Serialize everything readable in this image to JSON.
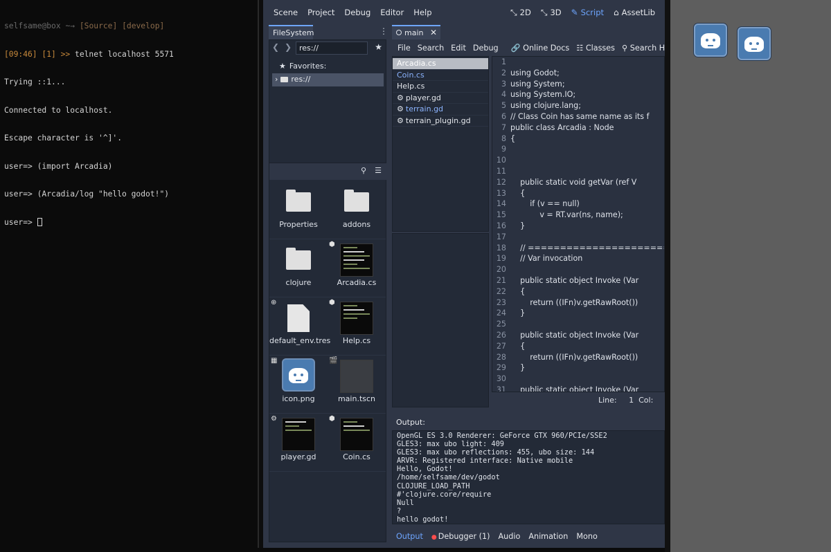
{
  "terminal": {
    "prompt_user": "selfsame",
    "prompt_at": "@",
    "prompt_host": "box",
    "prompt_rest": " ~→ ",
    "prompt_source": "[Source]",
    "prompt_branch": "[develop]",
    "time_prefix": "[09:46] [1] >> ",
    "command": "telnet localhost 5571",
    "lines": [
      "Trying ::1...",
      "Connected to localhost.",
      "Escape character is '^]'.",
      "user=> (import Arcadia)",
      "user=> (Arcadia/log \"hello godot!\")",
      "user=> "
    ]
  },
  "menubar": {
    "items": [
      "Scene",
      "Project",
      "Debug",
      "Editor",
      "Help"
    ],
    "modes": [
      {
        "label": "2D",
        "icon": "2d-icon",
        "glyph": "⤡"
      },
      {
        "label": "3D",
        "icon": "3d-icon",
        "glyph": "⤡"
      },
      {
        "label": "Script",
        "icon": "script-icon",
        "glyph": "✎"
      },
      {
        "label": "AssetLib",
        "icon": "assetlib-icon",
        "glyph": "⌂"
      }
    ],
    "active_mode": "Script"
  },
  "filesystem": {
    "tab_label": "FileSystem",
    "path_value": "res://",
    "favorites_label": "Favorites:",
    "root_label": "res://",
    "items": [
      {
        "name": "Properties",
        "kind": "folder"
      },
      {
        "name": "addons",
        "kind": "folder"
      },
      {
        "name": "clojure",
        "kind": "folder"
      },
      {
        "name": "Arcadia.cs",
        "kind": "script-thumb",
        "badge": "⬢"
      },
      {
        "name": "default_env.tres",
        "kind": "doc",
        "badge": "⊕"
      },
      {
        "name": "Help.cs",
        "kind": "script-thumb",
        "badge": "⬢"
      },
      {
        "name": "icon.png",
        "kind": "image",
        "badge": "▦"
      },
      {
        "name": "main.tscn",
        "kind": "scene-thumb",
        "badge": "🎬"
      },
      {
        "name": "player.gd",
        "kind": "script-thumb",
        "badge": "⚙"
      },
      {
        "name": "Coin.cs",
        "kind": "script-thumb",
        "badge": "⬢"
      }
    ]
  },
  "script_editor": {
    "tab_label": "main",
    "menu": {
      "file": "File",
      "search": "Search",
      "edit": "Edit",
      "debug": "Debug",
      "online_docs": "Online Docs",
      "classes": "Classes",
      "search_help": "Search Help"
    },
    "scripts": [
      {
        "name": "Arcadia.cs",
        "selected": true,
        "gd": false
      },
      {
        "name": "Coin.cs",
        "selected": false,
        "gd": false
      },
      {
        "name": "Help.cs",
        "selected": false,
        "gd": false
      },
      {
        "name": "player.gd",
        "selected": false,
        "gd": true
      },
      {
        "name": "terrain.gd",
        "selected": false,
        "gd": true
      },
      {
        "name": "terrain_plugin.gd",
        "selected": false,
        "gd": true
      }
    ],
    "code_lines": [
      [],
      [
        [
          "kw",
          "using"
        ],
        [
          "tx",
          " Godot;"
        ]
      ],
      [
        [
          "kw",
          "using"
        ],
        [
          "tx",
          " System;"
        ]
      ],
      [
        [
          "kw",
          "using"
        ],
        [
          "tx",
          " System.IO;"
        ]
      ],
      [
        [
          "kw",
          "using"
        ],
        [
          "tx",
          " clojure.lang;"
        ]
      ],
      [
        [
          "cm",
          "// Class Coin has same name as its f"
        ]
      ],
      [
        [
          "kw",
          "public"
        ],
        [
          "tx",
          " "
        ],
        [
          "kw",
          "class"
        ],
        [
          "tx",
          " Arcadia : "
        ],
        [
          "ty",
          "Node"
        ]
      ],
      [
        [
          "tx",
          "{"
        ]
      ],
      [],
      [],
      [],
      [
        [
          "tx",
          "    "
        ],
        [
          "kw",
          "public"
        ],
        [
          "tx",
          " "
        ],
        [
          "kw",
          "static"
        ],
        [
          "tx",
          " "
        ],
        [
          "kw",
          "void"
        ],
        [
          "tx",
          " "
        ],
        [
          "fn",
          "getVar"
        ],
        [
          "tx",
          " ("
        ],
        [
          "kw",
          "ref"
        ],
        [
          "tx",
          " V"
        ]
      ],
      [
        [
          "tx",
          "    {"
        ]
      ],
      [
        [
          "tx",
          "        "
        ],
        [
          "kw",
          "if"
        ],
        [
          "tx",
          " (v == "
        ],
        [
          "kw",
          "null"
        ],
        [
          "tx",
          ")"
        ]
      ],
      [
        [
          "tx",
          "            v = RT."
        ],
        [
          "fn",
          "var"
        ],
        [
          "tx",
          "(ns, name);"
        ]
      ],
      [
        [
          "tx",
          "    }"
        ]
      ],
      [],
      [
        [
          "tx",
          "    "
        ],
        [
          "cm",
          "// ==============================="
        ]
      ],
      [
        [
          "tx",
          "    "
        ],
        [
          "cm",
          "// Var invocation"
        ]
      ],
      [],
      [
        [
          "tx",
          "    "
        ],
        [
          "kw",
          "public"
        ],
        [
          "tx",
          " "
        ],
        [
          "kw",
          "static"
        ],
        [
          "tx",
          " "
        ],
        [
          "kw",
          "object"
        ],
        [
          "tx",
          " "
        ],
        [
          "fn",
          "Invoke"
        ],
        [
          "tx",
          " (Var"
        ]
      ],
      [
        [
          "tx",
          "    {"
        ]
      ],
      [
        [
          "tx",
          "        "
        ],
        [
          "kw",
          "return"
        ],
        [
          "tx",
          " ((IFn)v."
        ],
        [
          "fn",
          "getRawRoot"
        ],
        [
          "tx",
          "())"
        ]
      ],
      [
        [
          "tx",
          "    }"
        ]
      ],
      [],
      [
        [
          "tx",
          "    "
        ],
        [
          "kw",
          "public"
        ],
        [
          "tx",
          " "
        ],
        [
          "kw",
          "static"
        ],
        [
          "tx",
          " "
        ],
        [
          "kw",
          "object"
        ],
        [
          "tx",
          " "
        ],
        [
          "fn",
          "Invoke"
        ],
        [
          "tx",
          " (Var"
        ]
      ],
      [
        [
          "tx",
          "    {"
        ]
      ],
      [
        [
          "tx",
          "        "
        ],
        [
          "kw",
          "return"
        ],
        [
          "tx",
          " ((IFn)v."
        ],
        [
          "fn",
          "getRawRoot"
        ],
        [
          "tx",
          "())"
        ]
      ],
      [
        [
          "tx",
          "    }"
        ]
      ],
      [],
      [
        [
          "tx",
          "    "
        ],
        [
          "kw",
          "public"
        ],
        [
          "tx",
          " "
        ],
        [
          "kw",
          "static"
        ],
        [
          "tx",
          " "
        ],
        [
          "kw",
          "object"
        ],
        [
          "tx",
          " "
        ],
        [
          "fn",
          "Invoke"
        ],
        [
          "tx",
          " (Var"
        ]
      ]
    ],
    "status_line_label": "Line:",
    "status_line_value": "1",
    "status_col_label": "Col:"
  },
  "output": {
    "title": "Output:",
    "lines": [
      "OpenGL ES 3.0 Renderer: GeForce GTX 960/PCIe/SSE2",
      "GLES3: max ubo light: 409",
      "GLES3: max ubo reflections: 455, ubo size: 144",
      "ARVR: Registered interface: Native mobile",
      "Hello, Godot!",
      "/home/selfsame/dev/godot",
      "CLOJURE_LOAD_PATH",
      "#'clojure.core/require",
      "Null",
      "?",
      "hello godot!"
    ],
    "tabs": [
      "Output",
      "Debugger (1)",
      "Audio",
      "Animation",
      "Mono"
    ],
    "active_tab": "Output"
  },
  "colors": {
    "accent": "#6ea6ff",
    "editor_bg": "#2f3646",
    "panel_bg": "#232a37",
    "keyword": "#ff7085",
    "type": "#42ffc2",
    "function": "#57b3ff",
    "debug_dot": "#ff4d4d",
    "right_panel": "#5e5e5e"
  }
}
